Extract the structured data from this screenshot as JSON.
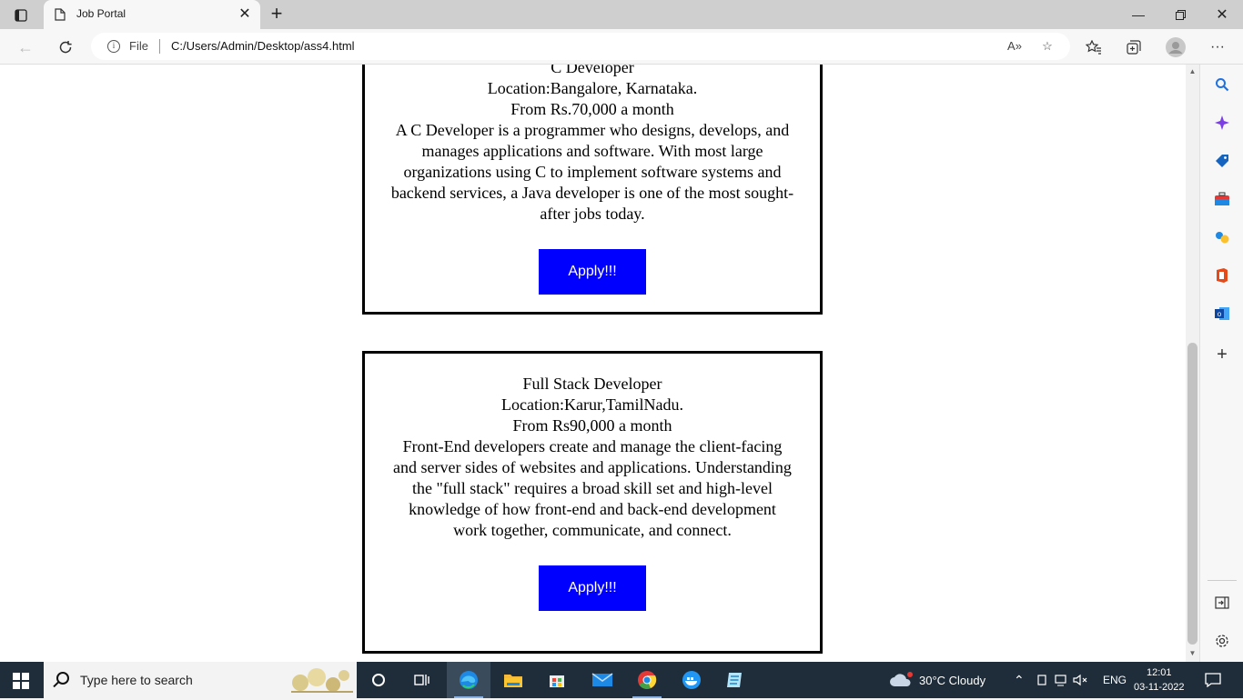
{
  "browser": {
    "tab_title": "Job Portal",
    "address": {
      "scheme_label": "File",
      "url": "C:/Users/Admin/Desktop/ass4.html"
    },
    "read_aloud_label": "A»"
  },
  "jobs": [
    {
      "title": "C Developer",
      "location": "Location:Bangalore, Karnataka.",
      "salary": "From Rs.70,000 a month",
      "description": "A C Developer is a programmer who designs, develops, and manages applications and software. With most large organizations using C to implement software systems and backend services, a Java developer is one of the most sought-after jobs today.",
      "apply_label": "Apply!!!"
    },
    {
      "title": "Full Stack Developer",
      "location": "Location:Karur,TamilNadu.",
      "salary": "From Rs90,000 a month",
      "description": "Front-End developers create and manage the client-facing and server sides of websites and applications. Understanding the \"full stack\" requires a broad skill set and high-level knowledge of how front-end and back-end development work together, communicate, and connect.",
      "apply_label": "Apply!!!"
    }
  ],
  "taskbar": {
    "search_placeholder": "Type here to search",
    "weather": "30°C  Cloudy",
    "language": "ENG",
    "time": "12:01",
    "date": "03-11-2022"
  },
  "colors": {
    "apply_button": "#0000ff",
    "taskbar": "#1f2d3a"
  }
}
